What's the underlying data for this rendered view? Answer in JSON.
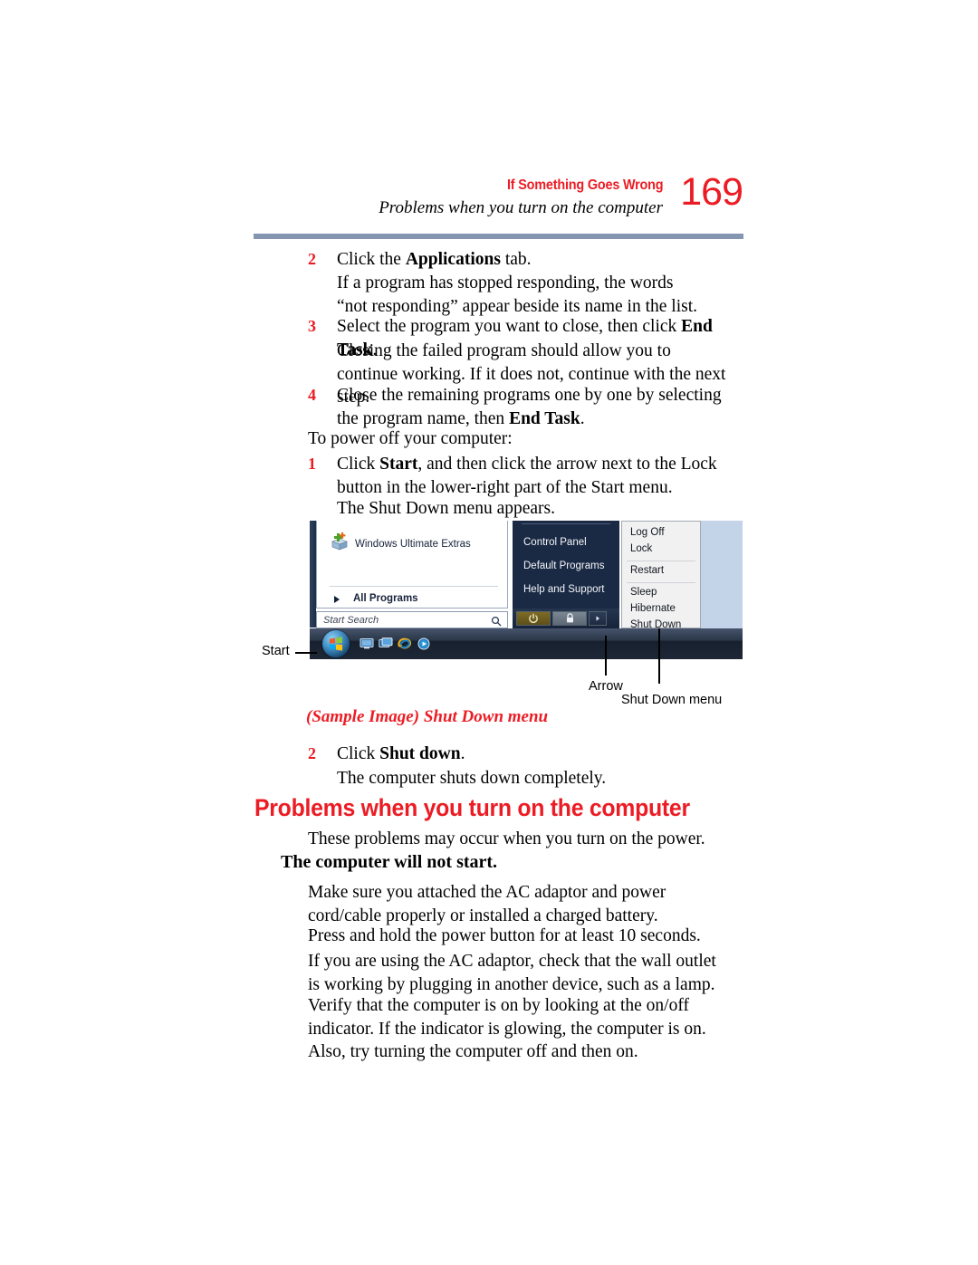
{
  "header": {
    "chapter": "If Something Goes Wrong",
    "section": "Problems when you turn on the computer",
    "page_number": "169",
    "rule_color": "#8496b2",
    "accent_color": "#ec1c24"
  },
  "body": {
    "step2_num": "2",
    "step2_text_a": "Click the ",
    "step2_bold": "Applications",
    "step2_text_b": " tab.",
    "para_notresponding": "If a program has stopped responding, the words “not responding” appear beside its name in the list.",
    "step3_num": "3",
    "step3_text_a": "Select the program you want to close, then click ",
    "step3_bold": "End Task",
    "step3_text_b": ".",
    "para_closing": "Closing the failed program should allow you to continue working. If it does not, continue with the next step.",
    "step4_num": "4",
    "step4_text_a": "Close the remaining programs one by one by selecting the program name, then ",
    "step4_bold": "End Task",
    "step4_text_b": ".",
    "para_poweroff": "To power off your computer:",
    "step1_num": "1",
    "step1_text_a": "Click ",
    "step1_bold": "Start",
    "step1_text_b": ", and then click the arrow next to the Lock button in the lower-right part of the Start menu.",
    "para_shutdownappears": "The Shut Down menu appears.",
    "step2b_num": "2",
    "step2b_text_a": "Click ",
    "step2b_bold": "Shut down",
    "step2b_text_b": ".",
    "para_shutscompletely": "The computer shuts down completely."
  },
  "figure": {
    "caption": "(Sample Image) Shut Down menu",
    "callouts": {
      "start": "Start",
      "arrow": "Arrow",
      "shutdown_menu": "Shut Down menu"
    },
    "start_menu": {
      "left_panel": {
        "ultimate_extras": "Windows Ultimate Extras",
        "all_programs": "All Programs",
        "search_placeholder": "Start Search"
      },
      "right_panel": [
        "Control Panel",
        "Default Programs",
        "Help and Support"
      ],
      "power_buttons": [
        "power-button",
        "lock-button",
        "arrow-button"
      ],
      "flyout_items": [
        "Log Off",
        "Lock",
        "Restart",
        "Sleep",
        "Hibernate",
        "Shut Down"
      ],
      "taskbar_icons": [
        "windows-orb",
        "show-desktop-icon",
        "switch-window-icon",
        "internet-explorer-icon",
        "media-player-icon"
      ]
    }
  },
  "section": {
    "heading": "Problems when you turn on the computer",
    "intro": "These problems may occur when you turn on the power.",
    "subheading": "The computer will not start.",
    "paragraphs": [
      "Make sure you attached the AC adaptor and power cord/cable properly or installed a charged battery.",
      "Press and hold the power button for at least 10 seconds.",
      "If you are using the AC adaptor, check that the wall outlet is working by plugging in another device, such as a lamp.",
      "Verify that the computer is on by looking at the on/off indicator. If the indicator is glowing, the computer is on. Also, try turning the computer off and then on."
    ]
  }
}
